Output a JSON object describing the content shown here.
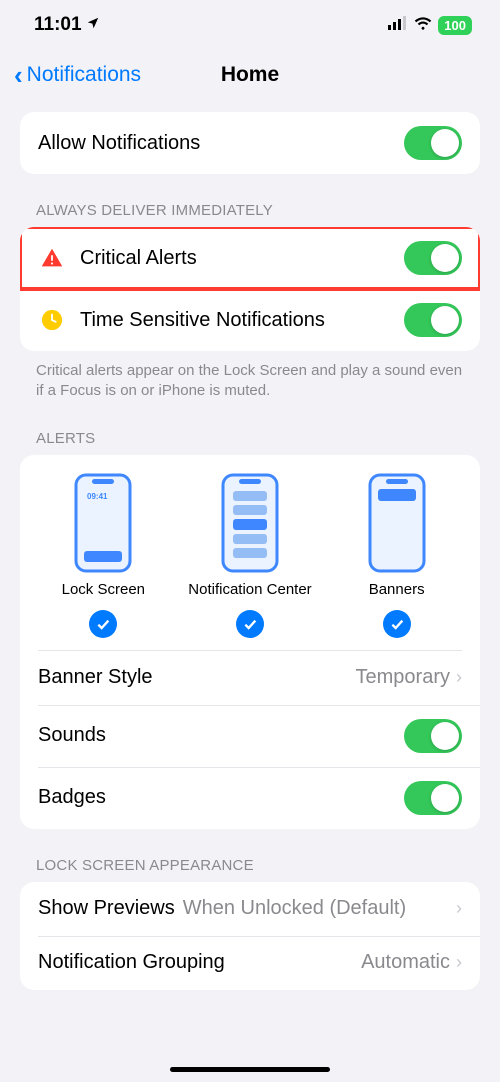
{
  "statusBar": {
    "time": "11:01",
    "battery": "100"
  },
  "nav": {
    "back": "Notifications",
    "title": "Home"
  },
  "rows": {
    "allowNotifications": "Allow Notifications"
  },
  "sections": {
    "alwaysDeliver": "ALWAYS DELIVER IMMEDIATELY",
    "criticalAlerts": "Critical Alerts",
    "timeSensitive": "Time Sensitive Notifications",
    "criticalFooter": "Critical alerts appear on the Lock Screen and play a sound even if a Focus is on or iPhone is muted.",
    "alertsHeader": "ALERTS"
  },
  "alertTypes": {
    "lockScreen": "Lock Screen",
    "notificationCenter": "Notification Center",
    "banners": "Banners",
    "previewTime": "09:41"
  },
  "settings": {
    "bannerStyle": "Banner Style",
    "bannerStyleValue": "Temporary",
    "sounds": "Sounds",
    "badges": "Badges"
  },
  "lockScreen": {
    "header": "LOCK SCREEN APPEARANCE",
    "showPreviews": "Show Previews",
    "showPreviewsValue": "When Unlocked (Default)",
    "grouping": "Notification Grouping",
    "groupingValue": "Automatic"
  }
}
